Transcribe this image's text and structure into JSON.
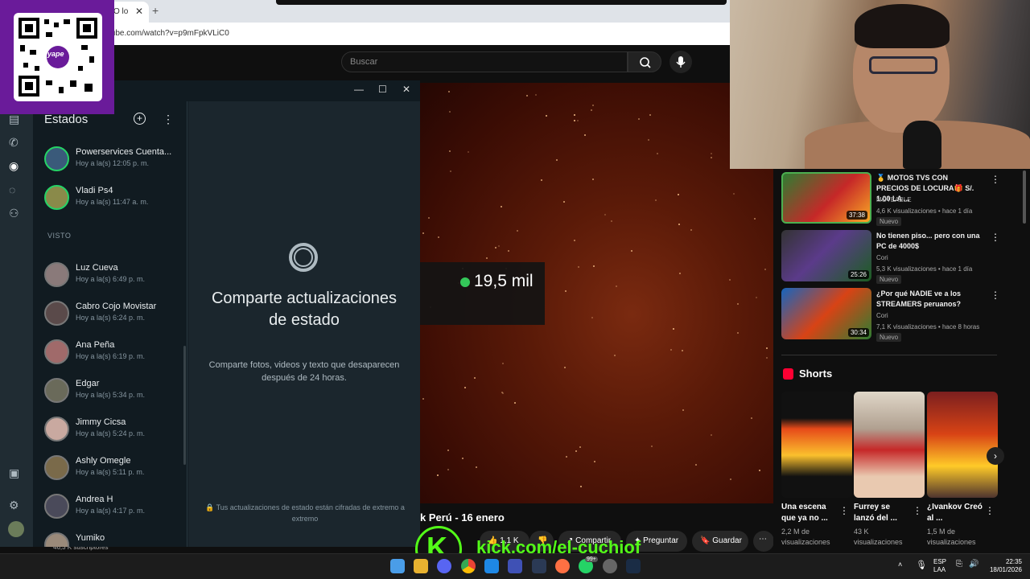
{
  "browser": {
    "tab_fragment": "O lo",
    "url": "tube.com/watch?v=p9mFpkVLiC0"
  },
  "youtube": {
    "search_placeholder": "Buscar",
    "viewer_count": "19,5 mil",
    "video_title": "k Perú - 16 enero",
    "likes": "1,1 K",
    "share_label": "Compartir",
    "ask_label": "Preguntar",
    "save_label": "Guardar",
    "channel_subs": "46,3 K suscriptores"
  },
  "whatsapp": {
    "heading": "Estados",
    "seen_label": "VISTO",
    "recent": [
      {
        "name": "Powerservices Cuenta...",
        "time": "Hoy a la(s) 12:05 p. m."
      },
      {
        "name": "Vladi Ps4",
        "time": "Hoy a la(s) 11:47 a. m."
      }
    ],
    "seen": [
      {
        "name": "Luz Cueva",
        "time": "Hoy a la(s) 6:49 p. m."
      },
      {
        "name": "Cabro Cojo Movistar",
        "time": "Hoy a la(s) 6:24 p. m."
      },
      {
        "name": "Ana Peña",
        "time": "Hoy a la(s) 6:19 p. m."
      },
      {
        "name": "Edgar",
        "time": "Hoy a la(s) 5:34 p. m."
      },
      {
        "name": "Jimmy Cicsa",
        "time": "Hoy a la(s) 5:24 p. m."
      },
      {
        "name": "Ashly Omegle",
        "time": "Hoy a la(s) 5:11 p. m."
      },
      {
        "name": "Andrea H",
        "time": "Hoy a la(s) 4:17 p. m."
      },
      {
        "name": "Yumiko",
        "time": ""
      }
    ],
    "main_title": "Comparte actualizaciones de estado",
    "main_subtitle": "Comparte fotos, videos y texto que desaparecen después de 24 horas.",
    "footer_note": "Tus actualizaciones de estado están cifradas de extremo a extremo"
  },
  "recommendations": [
    {
      "title": "🥇 MOTOS TVS CON PRECIOS DE LOCURA🎁 S/. 1.00 LA ...",
      "channel": "MOTEABLE",
      "meta": "4,6 K visualizaciones • hace 1 día",
      "badge": "Nuevo",
      "duration": "37:38"
    },
    {
      "title": "No tienen piso... pero con una PC de 4000$",
      "channel": "Cori",
      "meta": "5,3 K visualizaciones • hace 1 día",
      "badge": "Nuevo",
      "duration": "25:26"
    },
    {
      "title": "¿Por qué NADIE ve a los STREAMERS peruanos?",
      "channel": "Cori",
      "meta": "7,1 K visualizaciones • hace 8 horas",
      "badge": "Nuevo",
      "duration": "30:34"
    }
  ],
  "shorts": {
    "heading": "Shorts",
    "items": [
      {
        "title": "Una escena que ya no ...",
        "views": "2,2 M de visualizaciones"
      },
      {
        "title": "Furrey se lanzó del ...",
        "views": "43 K visualizaciones"
      },
      {
        "title": "¿Ivankov Creó al ...",
        "views": "1,5 M de visualizaciones"
      }
    ]
  },
  "overlay": {
    "kick_letter": "K",
    "kick_url": "kick.com/el-cuchiof"
  },
  "qr": {
    "brand": "yape"
  },
  "taskbar": {
    "lang": "ESP",
    "lang_sub": "LAA",
    "time": "22:35",
    "date": "18/01/2026",
    "whatsapp_badge": "99+"
  },
  "colors": {
    "whatsapp_green": "#25d366",
    "kick_green": "#53fc18",
    "youtube_red": "#ff0033",
    "yape_purple": "#6a1b9a"
  }
}
